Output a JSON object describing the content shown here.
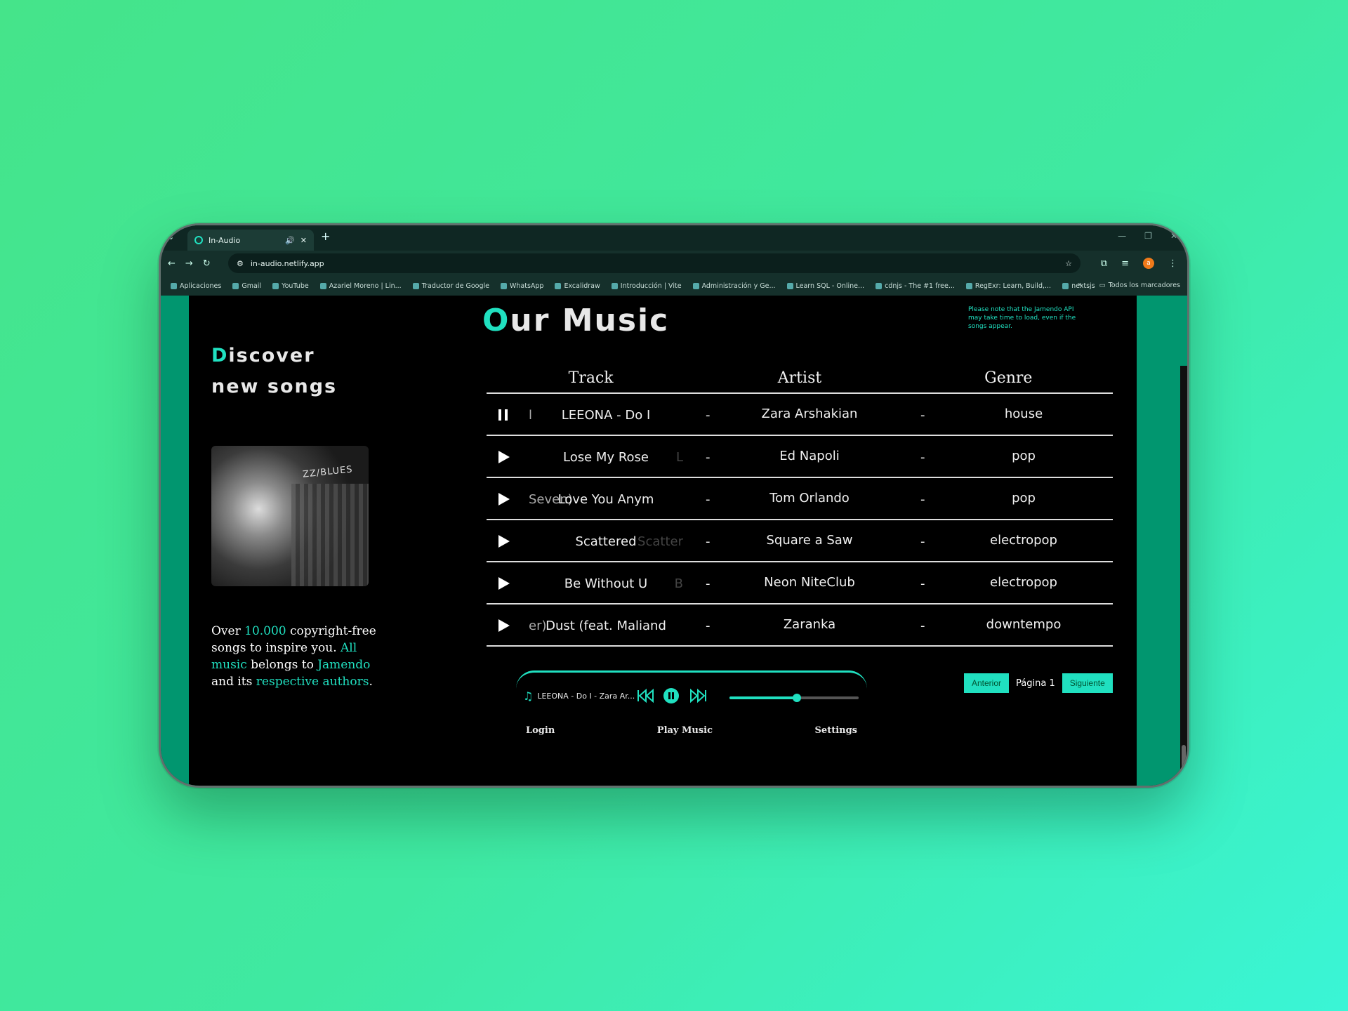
{
  "browser": {
    "tab_title": "In-Audio",
    "url": "in-audio.netlify.app",
    "bookmarks": [
      "Aplicaciones",
      "Gmail",
      "YouTube",
      "Azariel Moreno | Lin...",
      "Traductor de Google",
      "WhatsApp",
      "Excalidraw",
      "Introducción | Vite",
      "Administración y Ge...",
      "Learn SQL - Online...",
      "cdnjs - The #1 free...",
      "RegExr: Learn, Build,...",
      "nextsjs"
    ],
    "all_bookmarks": "Todos los marcadores",
    "avatar": "a"
  },
  "sidebar": {
    "heading_first": "D",
    "heading_rest": "iscover",
    "heading_line2": "new songs",
    "cover_sign": "ZZ/BLUES",
    "blurb": {
      "t1": "Over ",
      "h1": "10.000",
      "t2": " copyright-free songs to inspire you. ",
      "h2": "All music",
      "t3": " belongs to ",
      "h3": "Jamendo",
      "t4": " and its ",
      "h4": "respective authors",
      "t5": "."
    }
  },
  "main": {
    "title_first": "O",
    "title_rest": "ur Music",
    "note": "Please note that the Jamendo API may take time to load, even if the songs appear.",
    "columns": [
      "Track",
      "Artist",
      "Genre"
    ],
    "separator": "-",
    "tracks": [
      {
        "pre": "l",
        "title": "LEEONA - Do I",
        "post": "",
        "artist": "Zara Arshakian",
        "genre": "house",
        "state": "playing"
      },
      {
        "pre": "",
        "title": "Lose My Rose",
        "post": "L",
        "artist": "Ed Napoli",
        "genre": "pop",
        "state": "paused"
      },
      {
        "pre": "Seven)",
        "title": "Love You Anym",
        "post": "",
        "artist": "Tom Orlando",
        "genre": "pop",
        "state": "paused"
      },
      {
        "pre": "",
        "title": "Scattered",
        "post": "Scatter",
        "artist": "Square a Saw",
        "genre": "electropop",
        "state": "paused"
      },
      {
        "pre": "",
        "title": "Be Without U",
        "post": "B",
        "artist": "Neon NiteClub",
        "genre": "electropop",
        "state": "paused"
      },
      {
        "pre": "er)",
        "title": "Dust (feat. Maliand",
        "post": "",
        "artist": "Zaranka",
        "genre": "downtempo",
        "state": "paused"
      }
    ],
    "pager": {
      "prev": "Anterior",
      "page": "Página 1",
      "next": "Siguiente"
    }
  },
  "player": {
    "now_playing": "LEEONA - Do I - Zara Ar...",
    "progress": 0.52,
    "nav": [
      "Login",
      "Play Music",
      "Settings"
    ]
  },
  "colors": {
    "accent": "#20e0c0",
    "side": "#01966f",
    "bg": "#000000"
  }
}
